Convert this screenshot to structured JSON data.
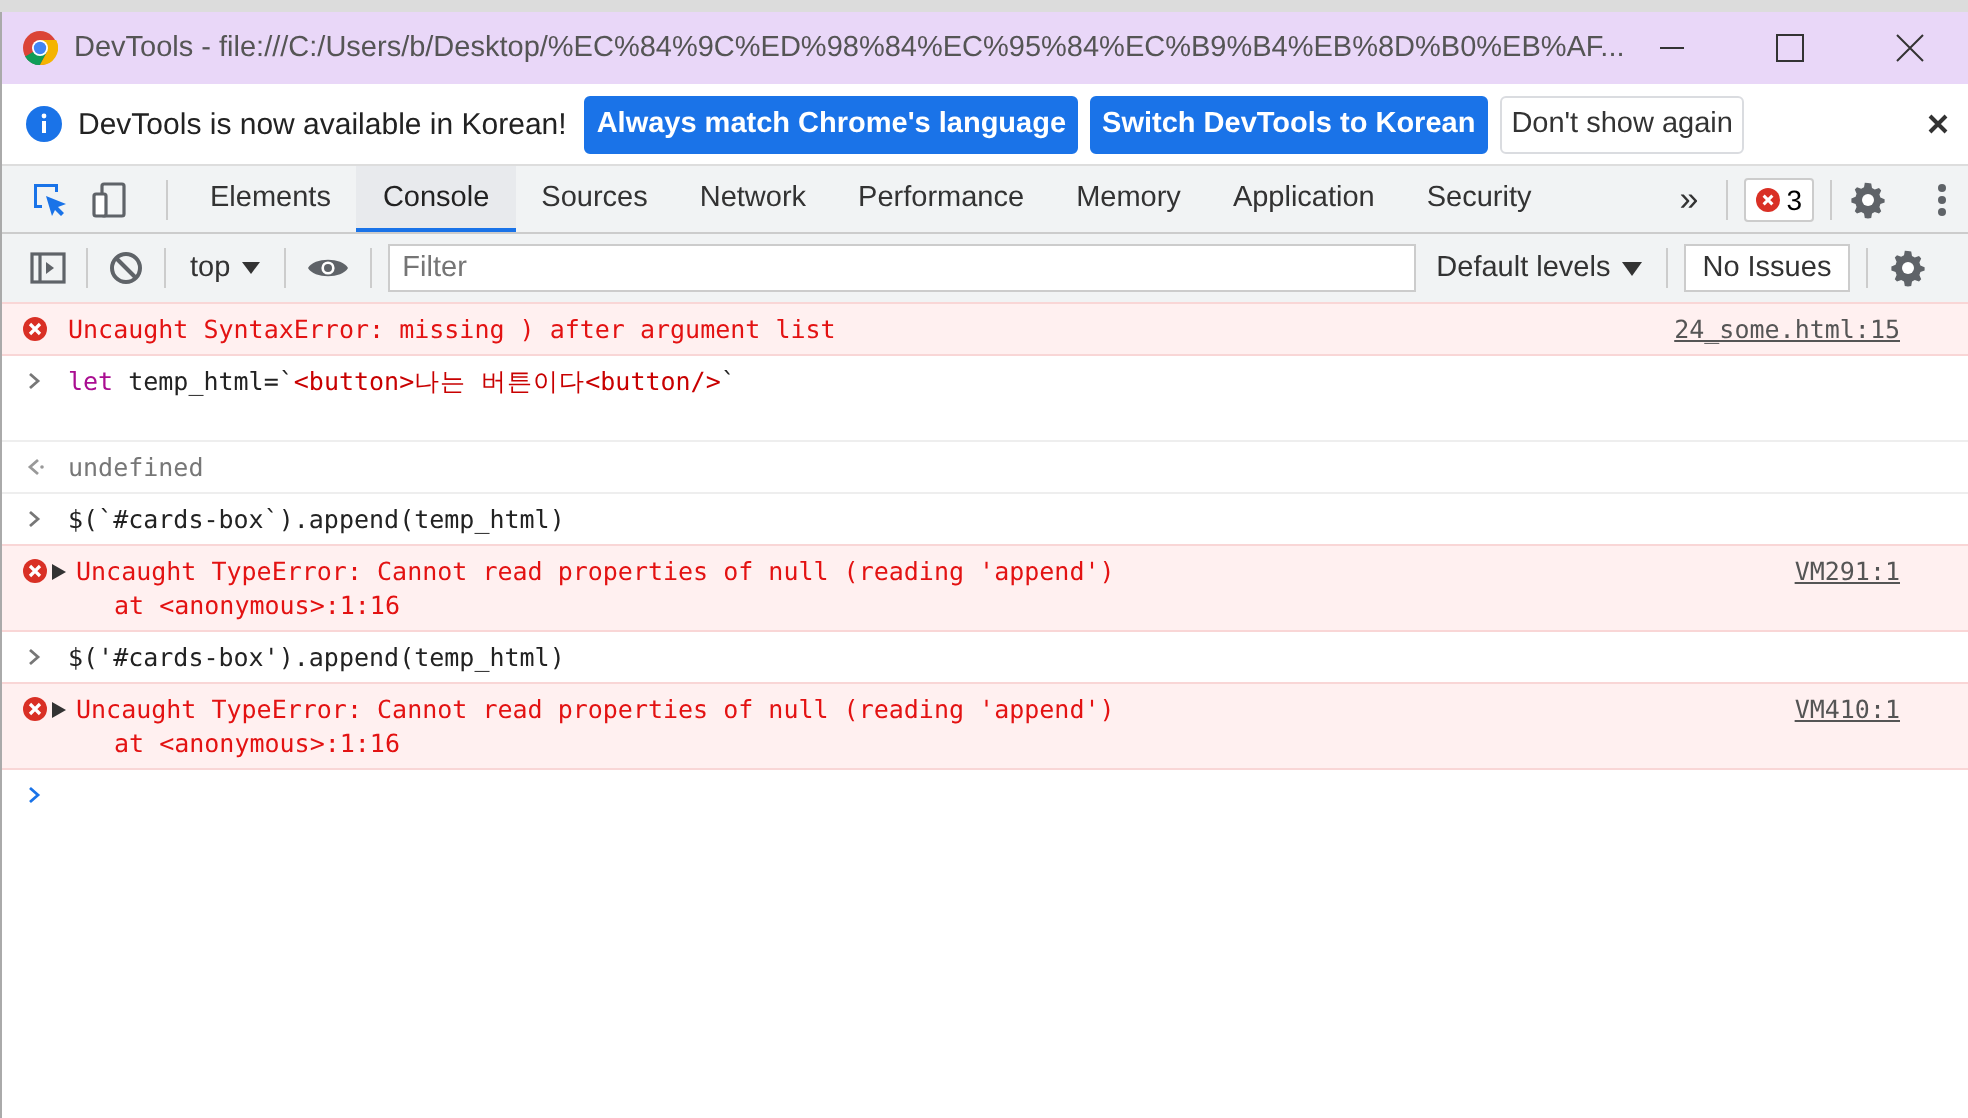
{
  "window": {
    "title": "DevTools - file:///C:/Users/b/Desktop/%EC%84%9C%ED%98%84%EC%95%84%EC%B9%B4%EB%8D%B0%EB%AF..."
  },
  "infobar": {
    "message": "DevTools is now available in Korean!",
    "buttons": [
      {
        "label": "Always match Chrome's language",
        "kind": "primary"
      },
      {
        "label": "Switch DevTools to Korean",
        "kind": "primary"
      },
      {
        "label": "Don't show again",
        "kind": "plain"
      }
    ]
  },
  "tabs": [
    {
      "label": "Elements",
      "selected": false
    },
    {
      "label": "Console",
      "selected": true
    },
    {
      "label": "Sources",
      "selected": false
    },
    {
      "label": "Network",
      "selected": false
    },
    {
      "label": "Performance",
      "selected": false
    },
    {
      "label": "Memory",
      "selected": false
    },
    {
      "label": "Application",
      "selected": false
    },
    {
      "label": "Security",
      "selected": false
    }
  ],
  "more_tabs": "»",
  "error_count": "3",
  "inspect_active": true,
  "console_toolbar": {
    "context": "top",
    "filter_placeholder": "Filter",
    "levels": "Default levels",
    "issues": "No Issues"
  },
  "messages": [
    {
      "kind": "error",
      "expandable": false,
      "text": "Uncaught SyntaxError: missing ) after argument list",
      "source": "24_some.html:15"
    },
    {
      "kind": "input",
      "tokens": [
        {
          "kind": "keyword",
          "text": "let"
        },
        {
          "kind": "plain",
          "text": " temp_html=`"
        },
        {
          "kind": "string",
          "text": "<button>나는 버튼이다<button/>"
        },
        {
          "kind": "plain",
          "text": "`\n\n"
        }
      ]
    },
    {
      "kind": "output",
      "text": "undefined"
    },
    {
      "kind": "input",
      "tokens": [
        {
          "kind": "plain",
          "text": "$(`#cards-box`).append(temp_html)"
        }
      ]
    },
    {
      "kind": "error",
      "expandable": true,
      "text": "Uncaught TypeError: Cannot read properties of null (reading 'append')",
      "detail": "at <anonymous>:1:16",
      "source": "VM291:1"
    },
    {
      "kind": "input",
      "tokens": [
        {
          "kind": "plain",
          "text": "$('#cards-box').append(temp_html)"
        }
      ]
    },
    {
      "kind": "error",
      "expandable": true,
      "text": "Uncaught TypeError: Cannot read properties of null (reading 'append')",
      "detail": "at <anonymous>:1:16",
      "source": "VM410:1"
    },
    {
      "kind": "prompt"
    }
  ]
}
